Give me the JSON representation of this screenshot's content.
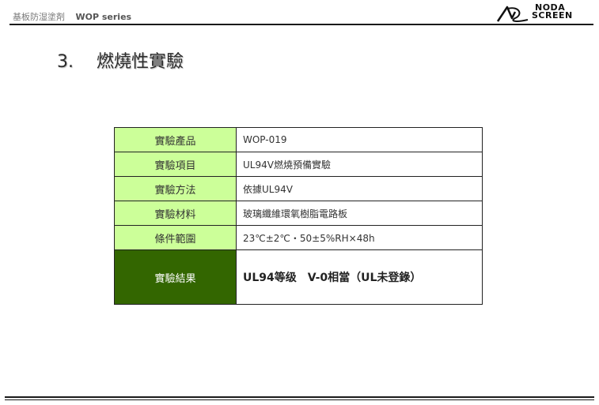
{
  "header": {
    "category": "基板防湿塗剤",
    "series": "WOP series"
  },
  "logo": {
    "line1": "NODA",
    "line2": "SCREEN"
  },
  "title": {
    "number": "3.",
    "text": "燃燒性實驗"
  },
  "table": {
    "rows": [
      {
        "label": "實驗產品",
        "value": "WOP-019"
      },
      {
        "label": "實驗項目",
        "value": "UL94V燃燒預備實驗"
      },
      {
        "label": "實驗方法",
        "value": "依據UL94V"
      },
      {
        "label": "實驗材料",
        "value": "玻璃纖維環氧樹脂電路板"
      },
      {
        "label": "條件範圍",
        "value": "23℃±2℃・50±5%RH×48h"
      },
      {
        "label": "實驗結果",
        "value": "UL94等级　V-0相當（UL未登錄）"
      }
    ]
  },
  "colors": {
    "label_bg": "#ccff99",
    "result_bg": "#336600"
  }
}
